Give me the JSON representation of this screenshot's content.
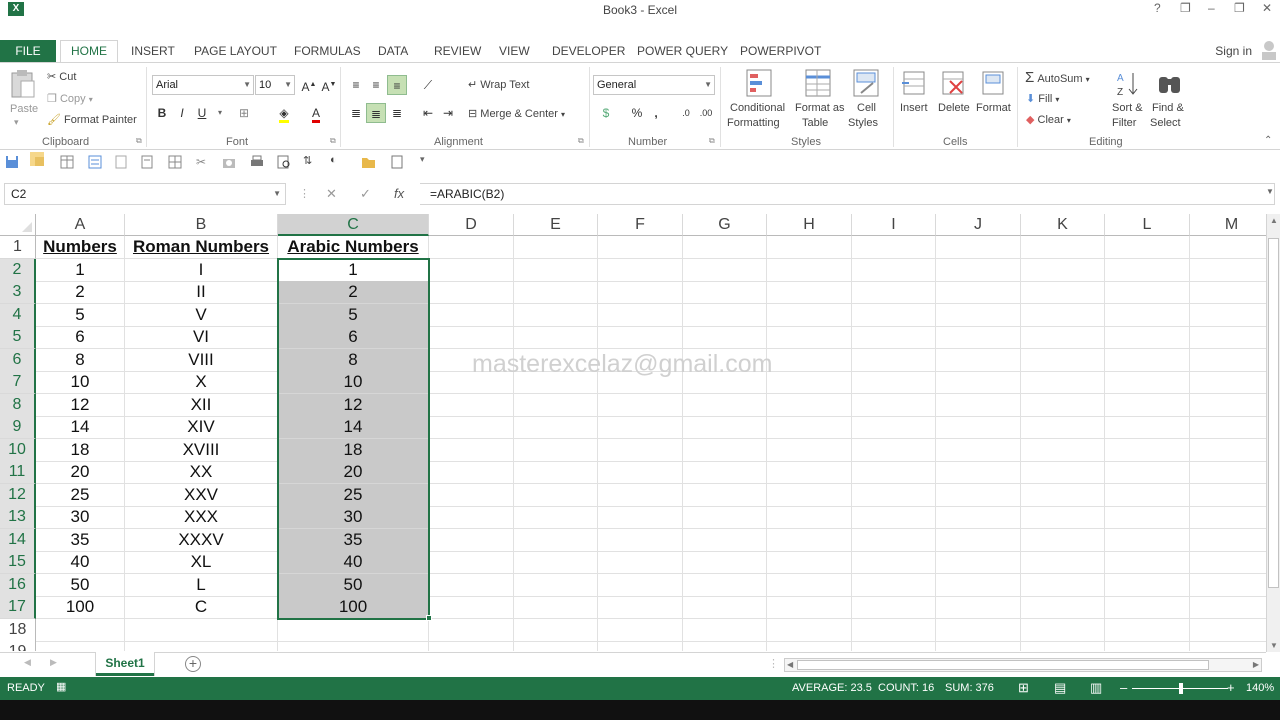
{
  "window": {
    "title": "Book3 - Excel",
    "app_badge": "X",
    "controls": [
      "?",
      "❐",
      "–",
      "❐",
      "✕"
    ]
  },
  "menu": {
    "file": "FILE",
    "tabs": [
      "HOME",
      "INSERT",
      "PAGE LAYOUT",
      "FORMULAS",
      "DATA",
      "REVIEW",
      "VIEW",
      "DEVELOPER",
      "POWER QUERY",
      "POWERPIVOT"
    ],
    "sign_in": "Sign in"
  },
  "ribbon": {
    "clipboard": {
      "paste": "Paste",
      "cut": "Cut",
      "copy": "Copy",
      "format_painter": "Format Painter",
      "group": "Clipboard"
    },
    "font": {
      "name": "Arial",
      "size": "10",
      "bold": "B",
      "italic": "I",
      "underline": "U",
      "group": "Font"
    },
    "alignment": {
      "wrap": "Wrap Text",
      "merge": "Merge & Center",
      "group": "Alignment"
    },
    "number": {
      "format": "General",
      "percent": "%",
      "comma": ",",
      "group": "Number"
    },
    "styles": {
      "conditional_1": "Conditional",
      "conditional_2": "Formatting",
      "format_as_1": "Format as",
      "format_as_2": "Table",
      "cell_styles_1": "Cell",
      "cell_styles_2": "Styles",
      "group": "Styles"
    },
    "cells": {
      "insert": "Insert",
      "delete": "Delete",
      "format": "Format",
      "group": "Cells"
    },
    "editing": {
      "autosum": "AutoSum",
      "fill": "Fill",
      "clear": "Clear",
      "sort_1": "Sort &",
      "sort_2": "Filter",
      "find_1": "Find &",
      "find_2": "Select",
      "group": "Editing"
    }
  },
  "formula_bar": {
    "name_box": "C2",
    "cancel": "✕",
    "enter": "✓",
    "fx": "fx",
    "formula": "=ARABIC(B2)"
  },
  "sheet": {
    "columns": [
      "A",
      "B",
      "C",
      "D",
      "E",
      "F",
      "G",
      "H",
      "I",
      "J",
      "K",
      "L",
      "M"
    ],
    "row_numbers": [
      "1",
      "2",
      "3",
      "4",
      "5",
      "6",
      "7",
      "8",
      "9",
      "10",
      "11",
      "12",
      "13",
      "14",
      "15",
      "16",
      "17",
      "18",
      "19"
    ],
    "headers": [
      "Numbers",
      "Roman Numbers",
      "Arabic Numbers"
    ],
    "rows": [
      [
        "1",
        "I",
        "1"
      ],
      [
        "2",
        "II",
        "2"
      ],
      [
        "5",
        "V",
        "5"
      ],
      [
        "6",
        "VI",
        "6"
      ],
      [
        "8",
        "VIII",
        "8"
      ],
      [
        "10",
        "X",
        "10"
      ],
      [
        "12",
        "XII",
        "12"
      ],
      [
        "14",
        "XIV",
        "14"
      ],
      [
        "18",
        "XVIII",
        "18"
      ],
      [
        "20",
        "XX",
        "20"
      ],
      [
        "25",
        "XXV",
        "25"
      ],
      [
        "30",
        "XXX",
        "30"
      ],
      [
        "35",
        "XXXV",
        "35"
      ],
      [
        "40",
        "XL",
        "40"
      ],
      [
        "50",
        "L",
        "50"
      ],
      [
        "100",
        "C",
        "100"
      ]
    ],
    "active_cell": "C2",
    "watermark": "masterexcelaz@gmail.com"
  },
  "tabs": {
    "sheet": "Sheet1",
    "add": "+"
  },
  "status": {
    "mode": "READY",
    "average": "AVERAGE: 23.5",
    "count": "COUNT: 16",
    "sum": "SUM: 376",
    "zoom": "140%",
    "minus": "–",
    "plus": "+"
  },
  "colors": {
    "accent": "#217346",
    "selection": "#c9c9c9"
  }
}
